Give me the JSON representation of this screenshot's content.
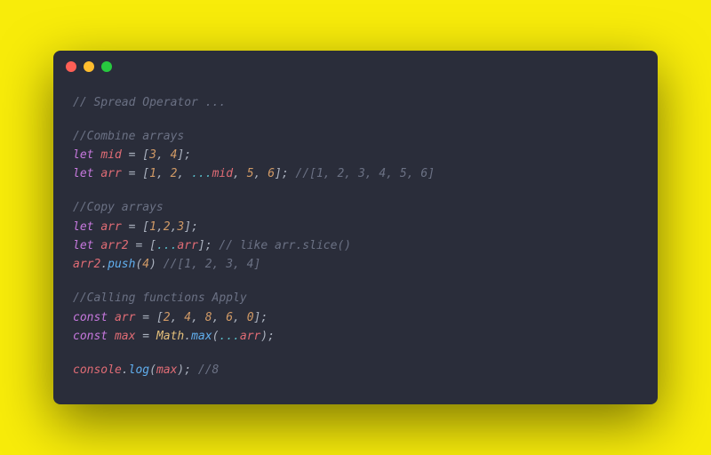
{
  "window": {
    "traffic": [
      "red",
      "yellow",
      "green"
    ]
  },
  "code": {
    "l1_comment": "// Spread Operator ...",
    "l3_comment": "//Combine arrays",
    "l4_let": "let",
    "l4_var": "mid",
    "l4_eq": " = ",
    "l4_open": "[",
    "l4_n1": "3",
    "l4_c1": ", ",
    "l4_n2": "4",
    "l4_close": "];",
    "l5_let": "let",
    "l5_var": "arr",
    "l5_eq": " = ",
    "l5_open": "[",
    "l5_n1": "1",
    "l5_c1": ", ",
    "l5_n2": "2",
    "l5_c2": ", ",
    "l5_spread": "...",
    "l5_mid": "mid",
    "l5_c3": ", ",
    "l5_n3": "5",
    "l5_c4": ", ",
    "l5_n4": "6",
    "l5_close": "]; ",
    "l5_comment": "//[1, 2, 3, 4, 5, 6]",
    "l7_comment": "//Copy arrays",
    "l8_let": "let",
    "l8_var": "arr",
    "l8_eq": " = ",
    "l8_open": "[",
    "l8_n1": "1",
    "l8_c1": ",",
    "l8_n2": "2",
    "l8_c2": ",",
    "l8_n3": "3",
    "l8_close": "];",
    "l9_let": "let",
    "l9_var": "arr2",
    "l9_eq": " = ",
    "l9_open": "[",
    "l9_spread": "...",
    "l9_arr": "arr",
    "l9_close": "]; ",
    "l9_comment": "// like arr.slice()",
    "l10_var": "arr2",
    "l10_dot": ".",
    "l10_push": "push",
    "l10_open": "(",
    "l10_n": "4",
    "l10_close": ") ",
    "l10_comment": "//[1, 2, 3, 4]",
    "l12_comment": "//Calling functions Apply",
    "l13_const": "const",
    "l13_var": "arr",
    "l13_eq": " = ",
    "l13_open": "[",
    "l13_n1": "2",
    "l13_c1": ", ",
    "l13_n2": "4",
    "l13_c2": ", ",
    "l13_n3": "8",
    "l13_c3": ", ",
    "l13_n4": "6",
    "l13_c4": ", ",
    "l13_n5": "0",
    "l13_close": "];",
    "l14_const": "const",
    "l14_var": "max",
    "l14_eq": " = ",
    "l14_math": "Math",
    "l14_dot": ".",
    "l14_max": "max",
    "l14_open": "(",
    "l14_spread": "...",
    "l14_arr": "arr",
    "l14_close": ");",
    "l16_console": "console",
    "l16_dot": ".",
    "l16_log": "log",
    "l16_open": "(",
    "l16_max": "max",
    "l16_close": "); ",
    "l16_comment": "//8"
  }
}
